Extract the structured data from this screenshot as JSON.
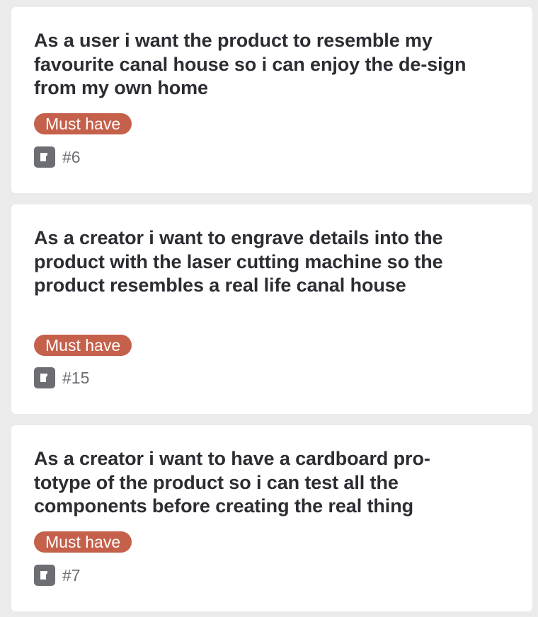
{
  "cards": [
    {
      "title": "As a user i want the product to resemble my favourite canal house so i can enjoy the de-sign from my own home",
      "badge": "Must have",
      "ref": "#6",
      "icon": "card-icon"
    },
    {
      "title": "As a creator i want to engrave details into the product with the laser cutting machine so the product resembles a real life canal house",
      "badge": "Must have",
      "ref": "#15",
      "icon": "card-icon"
    },
    {
      "title": "As a creator i want to have a cardboard pro-totype of the product so i can test all the components before creating the real thing",
      "badge": "Must have",
      "ref": "#7",
      "icon": "card-icon"
    }
  ],
  "colors": {
    "background": "#ebebec",
    "card": "#ffffff",
    "badge": "#c5604b",
    "icon": "#6d6e73",
    "title": "#2c2d33"
  }
}
